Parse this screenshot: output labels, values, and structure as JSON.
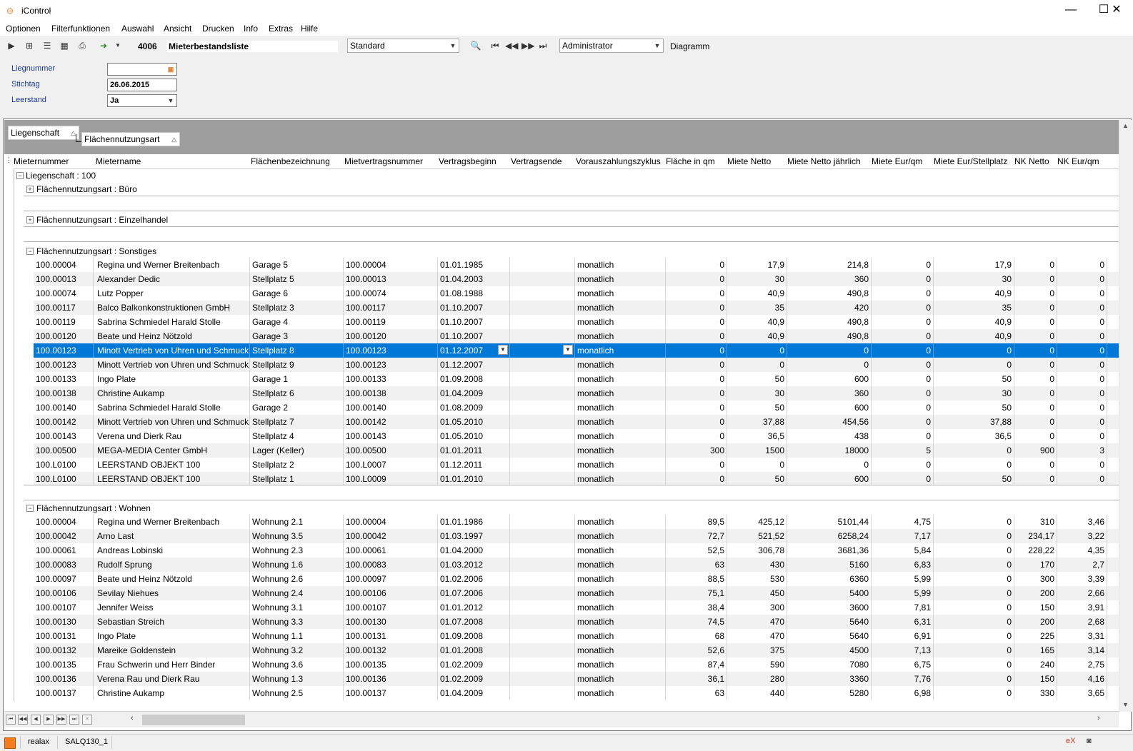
{
  "window": {
    "title": "iControl",
    "minimize": "—",
    "maximize": "☐",
    "close": "✕"
  },
  "menu": [
    "Optionen",
    "Filterfunktionen",
    "Auswahl",
    "Ansicht",
    "Drucken",
    "Info",
    "Extras",
    "Hilfe"
  ],
  "toolbar": {
    "report_number": "4006",
    "report_title": "Mieterbestandsliste",
    "layout_select": "Standard",
    "user_select": "Administrator",
    "diagram_label": "Diagramm"
  },
  "filters": [
    {
      "label": "Liegnummer",
      "value": ""
    },
    {
      "label": "Stichtag",
      "value": "26.06.2015"
    },
    {
      "label": "Leerstand",
      "value": "Ja"
    }
  ],
  "group_by": [
    "Liegenschaft",
    "Flächennutzungsart"
  ],
  "columns": [
    "Mieternummer",
    "Mietername",
    "Flächenbezeichnung",
    "Mietvertragsnummer",
    "Vertragsbeginn",
    "Vertragsende",
    "Vorauszahlungszyklus",
    "Fläche in qm",
    "Miete Netto",
    "Miete Netto jährlich",
    "Miete Eur/qm",
    "Miete Eur/Stellplatz",
    "NK Netto",
    "NK Eur/qm"
  ],
  "groups": {
    "liegenschaft": "Liegenschaft : 100",
    "buero": "Flächennutzungsart : Büro",
    "einzelhandel": "Flächennutzungsart : Einzelhandel",
    "sonstiges": "Flächennutzungsart : Sonstiges",
    "wohnen": "Flächennutzungsart : Wohnen"
  },
  "rows_sonstiges": [
    [
      "100.00004",
      "Regina und Werner Breitenbach",
      "Garage 5",
      "100.00004",
      "01.01.1985",
      "",
      "monatlich",
      "0",
      "17,9",
      "214,8",
      "0",
      "17,9",
      "0",
      "0"
    ],
    [
      "100.00013",
      "Alexander Dedic",
      "Stellplatz 5",
      "100.00013",
      "01.04.2003",
      "",
      "monatlich",
      "0",
      "30",
      "360",
      "0",
      "30",
      "0",
      "0"
    ],
    [
      "100.00074",
      "Lutz Popper",
      "Garage 6",
      "100.00074",
      "01.08.1988",
      "",
      "monatlich",
      "0",
      "40,9",
      "490,8",
      "0",
      "40,9",
      "0",
      "0"
    ],
    [
      "100.00117",
      "Balco Balkonkonstruktionen GmbH",
      "Stellplatz 3",
      "100.00117",
      "01.10.2007",
      "",
      "monatlich",
      "0",
      "35",
      "420",
      "0",
      "35",
      "0",
      "0"
    ],
    [
      "100.00119",
      "Sabrina Schmiedel Harald Stolle",
      "Garage 4",
      "100.00119",
      "01.10.2007",
      "",
      "monatlich",
      "0",
      "40,9",
      "490,8",
      "0",
      "40,9",
      "0",
      "0"
    ],
    [
      "100.00120",
      "Beate und Heinz Nötzold",
      "Garage 3",
      "100.00120",
      "01.10.2007",
      "",
      "monatlich",
      "0",
      "40,9",
      "490,8",
      "0",
      "40,9",
      "0",
      "0"
    ],
    [
      "100.00123",
      "Minott Vertrieb von Uhren und Schmuck",
      "Stellplatz 8",
      "100.00123",
      "01.12.2007",
      "",
      "monatlich",
      "0",
      "0",
      "0",
      "0",
      "0",
      "0",
      "0"
    ],
    [
      "100.00123",
      "Minott Vertrieb von Uhren und Schmuck",
      "Stellplatz 9",
      "100.00123",
      "01.12.2007",
      "",
      "monatlich",
      "0",
      "0",
      "0",
      "0",
      "0",
      "0",
      "0"
    ],
    [
      "100.00133",
      "Ingo Plate",
      "Garage 1",
      "100.00133",
      "01.09.2008",
      "",
      "monatlich",
      "0",
      "50",
      "600",
      "0",
      "50",
      "0",
      "0"
    ],
    [
      "100.00138",
      "Christine Aukamp",
      "Stellplatz 6",
      "100.00138",
      "01.04.2009",
      "",
      "monatlich",
      "0",
      "30",
      "360",
      "0",
      "30",
      "0",
      "0"
    ],
    [
      "100.00140",
      "Sabrina Schmiedel Harald Stolle",
      "Garage 2",
      "100.00140",
      "01.08.2009",
      "",
      "monatlich",
      "0",
      "50",
      "600",
      "0",
      "50",
      "0",
      "0"
    ],
    [
      "100.00142",
      "Minott Vertrieb von Uhren und Schmuck",
      "Stellplatz 7",
      "100.00142",
      "01.05.2010",
      "",
      "monatlich",
      "0",
      "37,88",
      "454,56",
      "0",
      "37,88",
      "0",
      "0"
    ],
    [
      "100.00143",
      "Verena und Dierk Rau",
      "Stellplatz 4",
      "100.00143",
      "01.05.2010",
      "",
      "monatlich",
      "0",
      "36,5",
      "438",
      "0",
      "36,5",
      "0",
      "0"
    ],
    [
      "100.00500",
      "MEGA-MEDIA Center GmbH",
      "Lager (Keller)",
      "100.00500",
      "01.01.2011",
      "",
      "monatlich",
      "300",
      "1500",
      "18000",
      "5",
      "0",
      "900",
      "3"
    ],
    [
      "100.L0100",
      "LEERSTAND OBJEKT 100",
      "Stellplatz 2",
      "100.L0007",
      "01.12.2011",
      "",
      "monatlich",
      "0",
      "0",
      "0",
      "0",
      "0",
      "0",
      "0"
    ],
    [
      "100.L0100",
      "LEERSTAND OBJEKT 100",
      "Stellplatz 1",
      "100.L0009",
      "01.01.2010",
      "",
      "monatlich",
      "0",
      "50",
      "600",
      "0",
      "50",
      "0",
      "0"
    ]
  ],
  "rows_wohnen": [
    [
      "100.00004",
      "Regina und Werner Breitenbach",
      "Wohnung 2.1",
      "100.00004",
      "01.01.1986",
      "",
      "monatlich",
      "89,5",
      "425,12",
      "5101,44",
      "4,75",
      "0",
      "310",
      "3,46"
    ],
    [
      "100.00042",
      "Arno Last",
      "Wohnung 3.5",
      "100.00042",
      "01.03.1997",
      "",
      "monatlich",
      "72,7",
      "521,52",
      "6258,24",
      "7,17",
      "0",
      "234,17",
      "3,22"
    ],
    [
      "100.00061",
      "Andreas Lobinski",
      "Wohnung 2.3",
      "100.00061",
      "01.04.2000",
      "",
      "monatlich",
      "52,5",
      "306,78",
      "3681,36",
      "5,84",
      "0",
      "228,22",
      "4,35"
    ],
    [
      "100.00083",
      "Rudolf Sprung",
      "Wohnung 1.6",
      "100.00083",
      "01.03.2012",
      "",
      "monatlich",
      "63",
      "430",
      "5160",
      "6,83",
      "0",
      "170",
      "2,7"
    ],
    [
      "100.00097",
      "Beate und Heinz Nötzold",
      "Wohnung 2.6",
      "100.00097",
      "01.02.2006",
      "",
      "monatlich",
      "88,5",
      "530",
      "6360",
      "5,99",
      "0",
      "300",
      "3,39"
    ],
    [
      "100.00106",
      "Sevilay Niehues",
      "Wohnung 2.4",
      "100.00106",
      "01.07.2006",
      "",
      "monatlich",
      "75,1",
      "450",
      "5400",
      "5,99",
      "0",
      "200",
      "2,66"
    ],
    [
      "100.00107",
      "Jennifer Weiss",
      "Wohnung 3.1",
      "100.00107",
      "01.01.2012",
      "",
      "monatlich",
      "38,4",
      "300",
      "3600",
      "7,81",
      "0",
      "150",
      "3,91"
    ],
    [
      "100.00130",
      "Sebastian Streich",
      "Wohnung 3.3",
      "100.00130",
      "01.07.2008",
      "",
      "monatlich",
      "74,5",
      "470",
      "5640",
      "6,31",
      "0",
      "200",
      "2,68"
    ],
    [
      "100.00131",
      "Ingo Plate",
      "Wohnung 1.1",
      "100.00131",
      "01.09.2008",
      "",
      "monatlich",
      "68",
      "470",
      "5640",
      "6,91",
      "0",
      "225",
      "3,31"
    ],
    [
      "100.00132",
      "Mareike Goldenstein",
      "Wohnung 3.2",
      "100.00132",
      "01.01.2008",
      "",
      "monatlich",
      "52,6",
      "375",
      "4500",
      "7,13",
      "0",
      "165",
      "3,14"
    ],
    [
      "100.00135",
      "Frau Schwerin und Herr Binder",
      "Wohnung 3.6",
      "100.00135",
      "01.02.2009",
      "",
      "monatlich",
      "87,4",
      "590",
      "7080",
      "6,75",
      "0",
      "240",
      "2,75"
    ],
    [
      "100.00136",
      "Verena Rau und Dierk Rau",
      "Wohnung 1.3",
      "100.00136",
      "01.02.2009",
      "",
      "monatlich",
      "36,1",
      "280",
      "3360",
      "7,76",
      "0",
      "150",
      "4,16"
    ],
    [
      "100.00137",
      "Christine Aukamp",
      "Wohnung 2.5",
      "100.00137",
      "01.04.2009",
      "",
      "monatlich",
      "63",
      "440",
      "5280",
      "6,98",
      "0",
      "330",
      "3,65"
    ]
  ],
  "selected_row": 6,
  "status": {
    "user": "realax",
    "db": "SALQ130_1"
  },
  "colors": {
    "selection": "#0078d7",
    "accent": "#f47c20"
  }
}
